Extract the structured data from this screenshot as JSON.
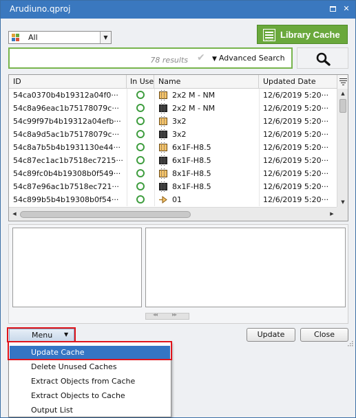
{
  "window": {
    "title": "Arudiuno.qproj"
  },
  "toolbar": {
    "filter_value": "All",
    "library_cache_label": "Library Cache",
    "library_cache_icon_caption": "CACHE",
    "results_text": "78 results",
    "advanced_search_label": "Advanced Search",
    "search_icon": "magnifier-icon"
  },
  "table": {
    "columns": [
      "ID",
      "In Use",
      "Name",
      "Updated Date"
    ],
    "rows": [
      {
        "id": "54ca0370b4b19312a04f0···",
        "name": "2x2 M - NM",
        "date": "12/6/2019 5:20···",
        "chip": "gold"
      },
      {
        "id": "54c8a96eac1b75178079c···",
        "name": "2x2 M - NM",
        "date": "12/6/2019 5:20···",
        "chip": "dark"
      },
      {
        "id": "54c99f97b4b19312a04efb···",
        "name": "3x2",
        "date": "12/6/2019 5:20···",
        "chip": "gold"
      },
      {
        "id": "54c8a9d5ac1b75178079c···",
        "name": "3x2",
        "date": "12/6/2019 5:20···",
        "chip": "dark"
      },
      {
        "id": "54c8a7b5b4b1931130e44···",
        "name": "6x1F-H8.5",
        "date": "12/6/2019 5:20···",
        "chip": "gold"
      },
      {
        "id": "54c87ec1ac1b7518ec7215···",
        "name": "6x1F-H8.5",
        "date": "12/6/2019 5:20···",
        "chip": "dark"
      },
      {
        "id": "54c89fc0b4b19308b0f549···",
        "name": "8x1F-H8.5",
        "date": "12/6/2019 5:20···",
        "chip": "gold"
      },
      {
        "id": "54c87e96ac1b7518ec721···",
        "name": "8x1F-H8.5",
        "date": "12/6/2019 5:20···",
        "chip": "dark"
      },
      {
        "id": "54c899b5b4b19308b0f54···",
        "name": "01",
        "date": "12/6/2019 5:20···",
        "chip": "pin"
      }
    ]
  },
  "pager": {
    "prev": "◂◂",
    "next": "▸▸"
  },
  "buttons": {
    "menu": "Menu",
    "update": "Update",
    "close": "Close"
  },
  "menu_items": [
    "Update Cache",
    "Delete Unused Caches",
    "Extract Objects from Cache",
    "Extract Objects to Cache",
    "Output List"
  ],
  "colors": {
    "accent_green": "#6aa83c",
    "highlight_red": "#e0141b",
    "selection_blue": "#3575c4",
    "in_use_ring": "#3e9d3e"
  }
}
